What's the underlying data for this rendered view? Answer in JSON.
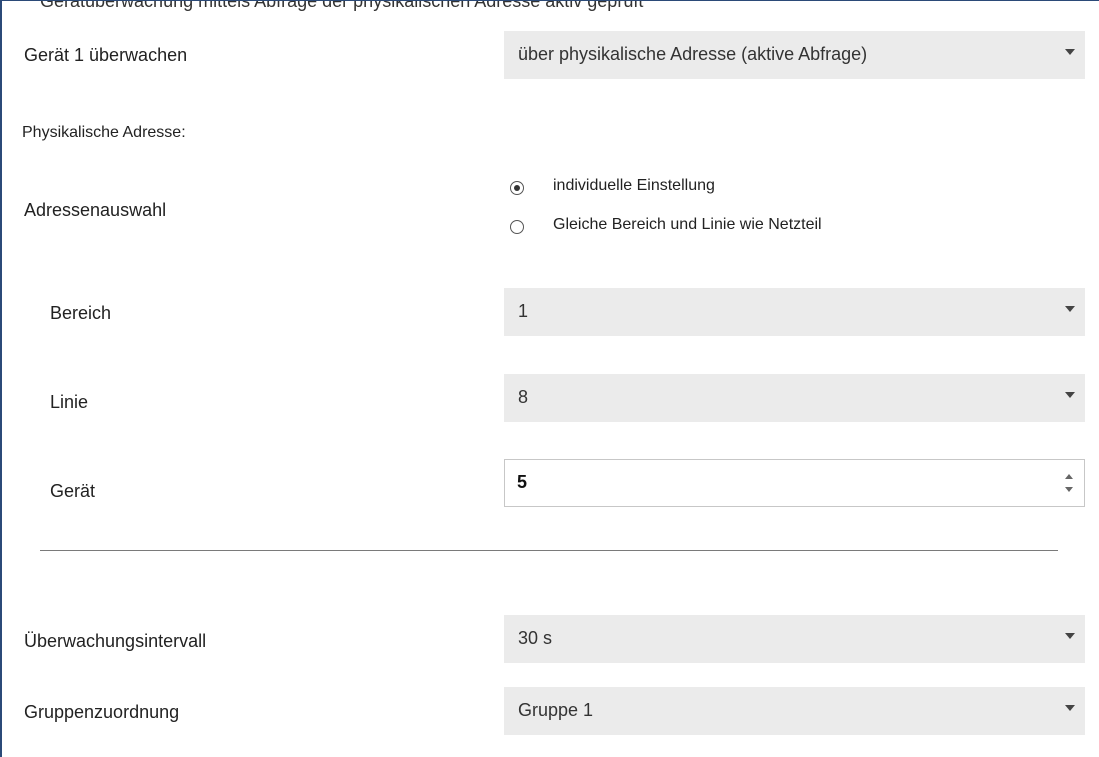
{
  "top_cut_text": "Gerätüberwachung mittels Abfrage der physikalischen Adresse aktiv geprüft",
  "fields": {
    "monitor_device": {
      "label": "Gerät 1 überwachen",
      "value": "über physikalische Adresse (aktive Abfrage)"
    },
    "section_title": "Physikalische Adresse:",
    "address_selection": {
      "label": "Adressenauswahl",
      "options": [
        {
          "label": "individuelle Einstellung",
          "checked": true
        },
        {
          "label": "Gleiche Bereich und Linie wie Netzteil",
          "checked": false
        }
      ]
    },
    "area": {
      "label": "Bereich",
      "value": "1"
    },
    "line": {
      "label": "Linie",
      "value": "8"
    },
    "device": {
      "label": "Gerät",
      "value": "5"
    },
    "interval": {
      "label": "Überwachungsintervall",
      "value": "30 s"
    },
    "group": {
      "label": "Gruppenzuordnung",
      "value": "Gruppe 1"
    }
  },
  "icons": {
    "dropdown": "chevron-down-icon",
    "spin_up": "arrow-up-icon",
    "spin_down": "arrow-down-icon"
  },
  "colors": {
    "dropdown_bg": "#ebebeb",
    "border_accent": "#2b4a78"
  }
}
